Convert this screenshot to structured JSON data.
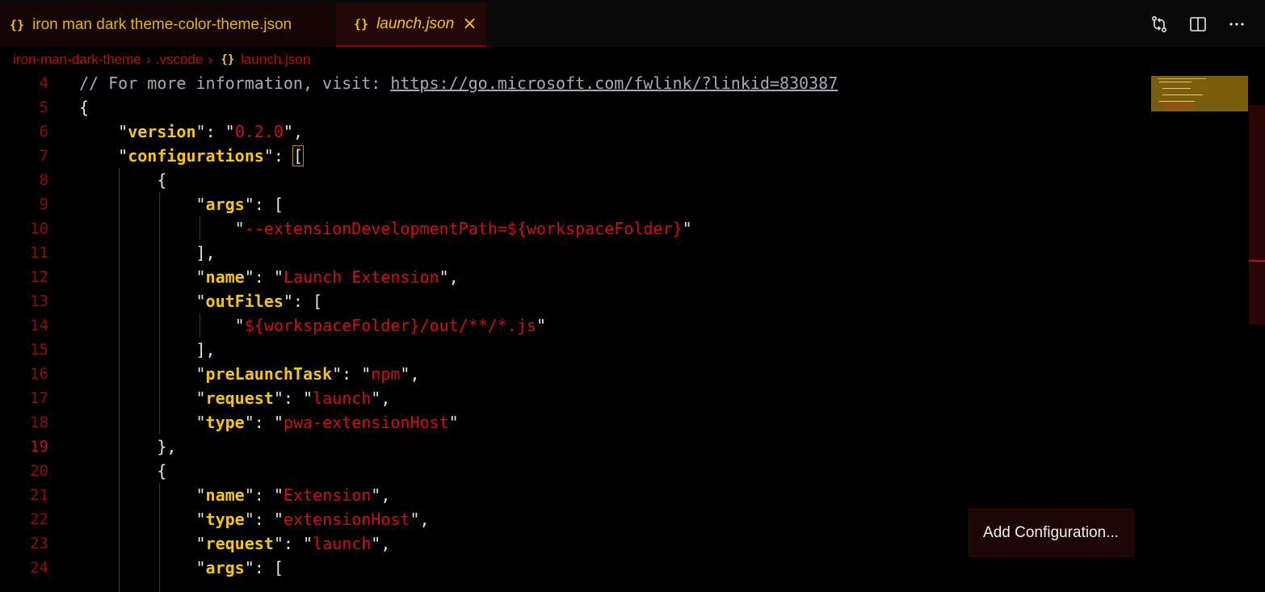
{
  "tabs": [
    {
      "icon": "{}",
      "label": "iron man dark theme-color-theme.json",
      "active": false
    },
    {
      "icon": "{}",
      "label": "launch.json",
      "active": true,
      "close": "×"
    }
  ],
  "actions": [
    "compare-changes-icon",
    "split-editor-icon",
    "more-actions-icon"
  ],
  "breadcrumb": {
    "items": [
      "iron-man-dark-theme",
      ".vscode",
      "launch.json"
    ],
    "file_icon": "{}",
    "separator": "›"
  },
  "editor": {
    "line_numbers": [
      "4",
      "5",
      "6",
      "7",
      "8",
      "9",
      "10",
      "11",
      "12",
      "13",
      "14",
      "15",
      "16",
      "17",
      "18",
      "19",
      "20",
      "21",
      "22",
      "23",
      "24"
    ],
    "active_line": "19",
    "comment": {
      "text": "// For more information, visit: ",
      "link": "https://go.microsoft.com/fwlink/?linkid=830387"
    },
    "lines": {
      "l5": "{",
      "version_key": "version",
      "version_val": "0.2.0",
      "configurations_key": "configurations",
      "l8": "{",
      "args_key": "args",
      "args_val": "--extensionDevelopmentPath=${workspaceFolder}",
      "l11": "],",
      "name_key": "name",
      "name_val": "Launch Extension",
      "outfiles_key": "outFiles",
      "outfiles_val": "${workspaceFolder}/out/**/*.js",
      "l15": "],",
      "prelaunch_key": "preLaunchTask",
      "prelaunch_val": "npm",
      "request_key": "request",
      "request_val": "launch",
      "type_key": "type",
      "type_val": "pwa-extensionHost",
      "l19": "},",
      "l20": "{",
      "name2_key": "name",
      "name2_val": "Extension",
      "type2_key": "type",
      "type2_val": "extensionHost",
      "request2_key": "request",
      "request2_val": "launch",
      "args2_key": "args"
    }
  },
  "add_configuration": {
    "label": "Add Configuration..."
  },
  "colors": {
    "background": "#000000",
    "accent_gold": "#f5c518",
    "accent_red": "#d20f0f",
    "line_number": "#8a1010"
  }
}
